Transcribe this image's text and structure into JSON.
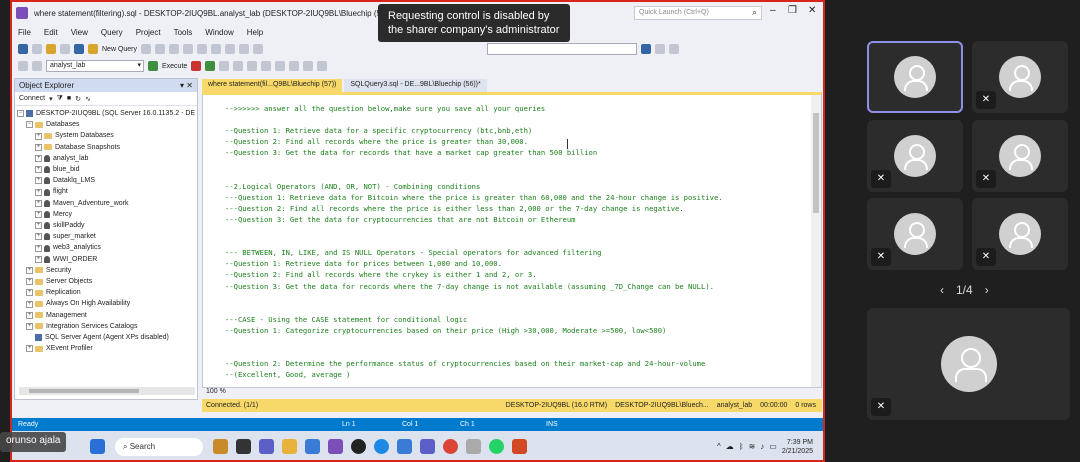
{
  "title": "where statement(filtering).sql - DESKTOP-2IUQ9BL.analyst_lab (DESKTOP-2IUQ9BL\\Bluechip (57)) - Mi",
  "quick_launch": "Quick Launch (Ctrl+Q)",
  "tooltip": "Requesting control is disabled by the sharer company's administrator",
  "menu": [
    "File",
    "Edit",
    "View",
    "Query",
    "Project",
    "Tools",
    "Window",
    "Help"
  ],
  "toolbar": {
    "new_query": "New Query",
    "database": "analyst_lab",
    "execute": "Execute"
  },
  "object_explorer": {
    "title": "Object Explorer",
    "connect": "Connect",
    "tree": [
      {
        "label": "DESKTOP-2IUQ9BL (SQL Server 16.0.1135.2 - DE",
        "icon": "server",
        "indent": 0,
        "exp": "⊟"
      },
      {
        "label": "Databases",
        "icon": "folder",
        "indent": 1,
        "exp": "⊟"
      },
      {
        "label": "System Databases",
        "icon": "folder",
        "indent": 2,
        "exp": "⊞"
      },
      {
        "label": "Database Snapshots",
        "icon": "folder",
        "indent": 2,
        "exp": "⊞"
      },
      {
        "label": "analyst_lab",
        "icon": "db",
        "indent": 2,
        "exp": "⊞"
      },
      {
        "label": "blue_bid",
        "icon": "db",
        "indent": 2,
        "exp": "⊞"
      },
      {
        "label": "Dataklq_LMS",
        "icon": "db",
        "indent": 2,
        "exp": "⊞"
      },
      {
        "label": "flight",
        "icon": "db",
        "indent": 2,
        "exp": "⊞"
      },
      {
        "label": "Maven_Adventure_work",
        "icon": "db",
        "indent": 2,
        "exp": "⊞"
      },
      {
        "label": "Mercy",
        "icon": "db",
        "indent": 2,
        "exp": "⊞"
      },
      {
        "label": "skillPaddy",
        "icon": "db",
        "indent": 2,
        "exp": "⊞"
      },
      {
        "label": "super_market",
        "icon": "db",
        "indent": 2,
        "exp": "⊞"
      },
      {
        "label": "web3_analytics",
        "icon": "db",
        "indent": 2,
        "exp": "⊞"
      },
      {
        "label": "WWI_ORDER",
        "icon": "db",
        "indent": 2,
        "exp": "⊞"
      },
      {
        "label": "Security",
        "icon": "folder",
        "indent": 1,
        "exp": "⊞"
      },
      {
        "label": "Server Objects",
        "icon": "folder",
        "indent": 1,
        "exp": "⊞"
      },
      {
        "label": "Replication",
        "icon": "folder",
        "indent": 1,
        "exp": "⊞"
      },
      {
        "label": "Always On High Availability",
        "icon": "folder",
        "indent": 1,
        "exp": "⊞"
      },
      {
        "label": "Management",
        "icon": "folder",
        "indent": 1,
        "exp": "⊞"
      },
      {
        "label": "Integration Services Catalogs",
        "icon": "folder",
        "indent": 1,
        "exp": "⊞"
      },
      {
        "label": "SQL Server Agent (Agent XPs disabled)",
        "icon": "agent",
        "indent": 1,
        "exp": ""
      },
      {
        "label": "XEvent Profiler",
        "icon": "folder",
        "indent": 1,
        "exp": "⊞"
      }
    ]
  },
  "tabs": [
    "where statement(fil...Q9BL\\Bluechip (57))",
    "SQLQuery3.sql - DE...9BL\\Bluechip (56))*"
  ],
  "code_lines": [
    "-->>>>>> answer all the question below,make sure you save all your queries",
    "",
    "--Question 1: Retrieve data for a specific cryptocurrency (btc,bnb,eth)",
    "--Question 2: Find all records where the price is greater than 30,000.",
    "--Question 3: Get the data for records that have a market cap greater than 500 billion",
    "",
    "",
    "--2.Logical Operators (AND, OR, NOT) - Combining conditions",
    "---Question 1: Retrieve data for Bitcoin where the price is greater than 60,000 and the 24-hour change is positive.",
    "---Question 2: Find all records where the price is either less than 2,000 or the 7-day change is negative.",
    "---Question 3: Get the data for cryptocurrencies that are not Bitcoin or Ethereum",
    "",
    "",
    "--- BETWEEN, IN, LIKE, and IS NULL Operators - Special operators for advanced filtering",
    "--Question 1: Retrieve data for prices between 1,000 and 10,000.",
    "--Question 2: Find all records where the crykey is either 1 and 2, or 3.",
    "--Question 3: Get the data for records where the 7-day change is not available (assuming _7D_Change can be NULL).",
    "",
    "",
    "---CASE - Using the CASE statement for conditional logic",
    "--Question 1: Categorize cryptocurrencies based on their price (High >30,000, Moderate >=500, low<500)",
    "",
    "",
    "--Question 2: Determine the performance status of cryptocurrencies based on their market-cap and 24-hour-volume",
    "--(Excellent, Good, average )",
    "",
    "--Question 3: Determine if the cryptocurrency is in a 'Bullish'>0, 'Bearish'<0, or 'Stable'"
  ],
  "zoom": "100 %",
  "query_status": {
    "connected": "Connected. (1/1)",
    "server": "DESKTOP-2IUQ9BL (16.0 RTM)",
    "user": "DESKTOP-2IUQ9BL\\Bluech...",
    "db": "analyst_lab",
    "time": "00:00:00",
    "rows": "0 rows"
  },
  "status": {
    "ready": "Ready",
    "ln": "Ln 1",
    "col": "Col 1",
    "ch": "Ch 1",
    "ins": "INS"
  },
  "taskbar": {
    "search": "Search",
    "time": "7:39 PM",
    "date": "2/21/2025"
  },
  "presenter": "orunso ajala",
  "pager": "1/4",
  "colors": {
    "accent": "#f7d96a",
    "status_blue": "#007acc",
    "share_border": "#d9241b"
  }
}
